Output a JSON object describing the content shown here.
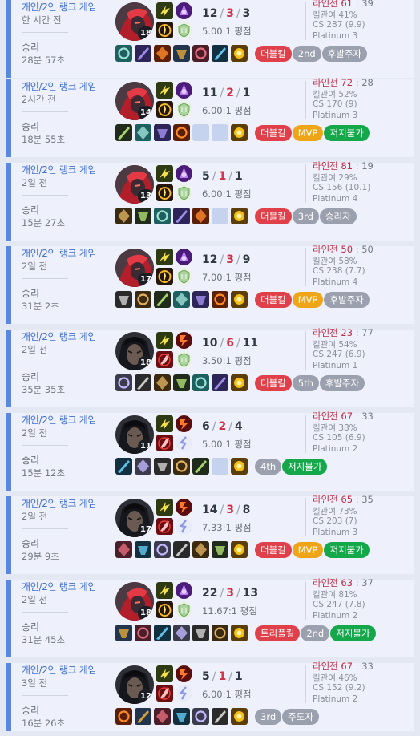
{
  "colors": {
    "accent": "#5a88e0",
    "card_bg": "#eef1fb",
    "death_red": "#d3334a",
    "lane_red": "#c02d45",
    "tag_red": "#e0404a",
    "tag_gray": "#9aa0ad",
    "tag_orange": "#f0a417",
    "tag_green": "#14a84a"
  },
  "matches": [
    {
      "queue": "개인/2인 랭크 게임",
      "time_ago": "한 시간 전",
      "result": "승리",
      "duration": "28분 57초",
      "champion_icon": "red-champion-icon",
      "champion_level": "18",
      "spells": [
        "flash-spell-icon",
        "ignite-spell-icon"
      ],
      "runes": [
        "conqueror-rune-icon",
        "resolve-rune-icon"
      ],
      "kills": "12",
      "deaths": "3",
      "assists": "3",
      "ratio": "5.00:1 평점",
      "items": [
        "item-icon",
        "item-icon",
        "item-icon",
        "item-icon",
        "item-icon",
        "item-icon",
        "ward-icon"
      ],
      "tags": [
        {
          "label": "더블킬",
          "color": "#e0404a"
        },
        {
          "label": "2nd",
          "color": "#9aa0ad"
        },
        {
          "label": "후발주자",
          "color": "#9aa0ad"
        }
      ],
      "lane_label": "라인전",
      "lane_win": "61",
      "lane_loss": "39",
      "kill_participation": "킬관여 41%",
      "cs": "CS 287 (9.9)",
      "tier": "Platinum 3"
    },
    {
      "queue": "개인/2인 랭크 게임",
      "time_ago": "2시간 전",
      "result": "승리",
      "duration": "18분 55초",
      "champion_icon": "red-champion-icon",
      "champion_level": "14",
      "spells": [
        "flash-spell-icon",
        "ignite-spell-icon"
      ],
      "runes": [
        "conqueror-rune-icon",
        "resolve-rune-icon"
      ],
      "kills": "11",
      "deaths": "2",
      "assists": "1",
      "ratio": "6.00:1 평점",
      "items": [
        "item-icon",
        "item-icon",
        "item-icon",
        "item-icon",
        "empty",
        "empty",
        "ward-icon"
      ],
      "tags": [
        {
          "label": "더블킬",
          "color": "#e0404a"
        },
        {
          "label": "MVP",
          "color": "#f0a417"
        },
        {
          "label": "저지불가",
          "color": "#14a84a"
        }
      ],
      "lane_label": "라인전",
      "lane_win": "72",
      "lane_loss": "28",
      "kill_participation": "킬관여 52%",
      "cs": "CS 170 (9)",
      "tier": "Platinum 3"
    },
    {
      "queue": "개인/2인 랭크 게임",
      "time_ago": "2일 전",
      "result": "승리",
      "duration": "15분 27초",
      "champion_icon": "red-champion-icon",
      "champion_level": "13",
      "spells": [
        "flash-spell-icon",
        "ignite-spell-icon"
      ],
      "runes": [
        "conqueror-rune-icon",
        "resolve-rune-icon"
      ],
      "kills": "5",
      "deaths": "1",
      "assists": "1",
      "ratio": "6.00:1 평점",
      "items": [
        "item-icon",
        "item-icon",
        "item-icon",
        "item-icon",
        "item-icon",
        "empty",
        "ward-icon"
      ],
      "tags": [
        {
          "label": "더블킬",
          "color": "#e0404a"
        },
        {
          "label": "3rd",
          "color": "#9aa0ad"
        },
        {
          "label": "승리자",
          "color": "#9aa0ad"
        }
      ],
      "lane_label": "라인전",
      "lane_win": "81",
      "lane_loss": "19",
      "kill_participation": "킬관여 29%",
      "cs": "CS 156 (10.1)",
      "tier": "Platinum 4"
    },
    {
      "queue": "개인/2인 랭크 게임",
      "time_ago": "2일 전",
      "result": "승리",
      "duration": "31분 2초",
      "champion_icon": "red-champion-icon",
      "champion_level": "17",
      "spells": [
        "flash-spell-icon",
        "ignite-spell-icon"
      ],
      "runes": [
        "conqueror-rune-icon",
        "resolve-rune-icon"
      ],
      "kills": "12",
      "deaths": "3",
      "assists": "9",
      "ratio": "7.00:1 평점",
      "items": [
        "item-icon",
        "item-icon",
        "item-icon",
        "item-icon",
        "item-icon",
        "item-icon",
        "ward-icon"
      ],
      "tags": [
        {
          "label": "더블킬",
          "color": "#e0404a"
        },
        {
          "label": "MVP",
          "color": "#f0a417"
        },
        {
          "label": "후발주자",
          "color": "#9aa0ad"
        }
      ],
      "lane_label": "라인전",
      "lane_win": "50",
      "lane_loss": "50",
      "kill_participation": "킬관여 58%",
      "cs": "CS 238 (7.7)",
      "tier": "Platinum 4"
    },
    {
      "queue": "개인/2인 랭크 게임",
      "time_ago": "2일 전",
      "result": "승리",
      "duration": "35분 35초",
      "champion_icon": "dark-champion-icon",
      "champion_level": "18",
      "spells": [
        "flash-spell-icon",
        "smite-spell-icon"
      ],
      "runes": [
        "electrocute-rune-icon",
        "resolve-rune-icon"
      ],
      "kills": "10",
      "deaths": "6",
      "assists": "11",
      "ratio": "3.50:1 평점",
      "items": [
        "item-icon",
        "item-icon",
        "item-icon",
        "item-icon",
        "item-icon",
        "item-icon",
        "ward-icon"
      ],
      "tags": [
        {
          "label": "더블킬",
          "color": "#e0404a"
        },
        {
          "label": "5th",
          "color": "#9aa0ad"
        },
        {
          "label": "후발주자",
          "color": "#9aa0ad"
        }
      ],
      "lane_label": "라인전",
      "lane_win": "23",
      "lane_loss": "77",
      "kill_participation": "킬관여 54%",
      "cs": "CS 247 (6.9)",
      "tier": "Platinum 1"
    },
    {
      "queue": "개인/2인 랭크 게임",
      "time_ago": "2일 전",
      "result": "승리",
      "duration": "15분 12초",
      "champion_icon": "dark-champion-icon",
      "champion_level": "11",
      "spells": [
        "flash-spell-icon",
        "smite-spell-icon"
      ],
      "runes": [
        "electrocute-rune-icon",
        "sorcery-rune-icon"
      ],
      "kills": "6",
      "deaths": "2",
      "assists": "4",
      "ratio": "5.00:1 평점",
      "items": [
        "item-icon",
        "item-icon",
        "item-icon",
        "item-icon",
        "item-icon",
        "empty",
        "ward-icon"
      ],
      "tags": [
        {
          "label": "4th",
          "color": "#9aa0ad"
        },
        {
          "label": "저지불가",
          "color": "#14a84a"
        }
      ],
      "lane_label": "라인전",
      "lane_win": "67",
      "lane_loss": "33",
      "kill_participation": "킬관여 38%",
      "cs": "CS 105 (6.9)",
      "tier": "Platinum 2"
    },
    {
      "queue": "개인/2인 랭크 게임",
      "time_ago": "2일 전",
      "result": "승리",
      "duration": "29분 9초",
      "champion_icon": "dark-champion-icon",
      "champion_level": "17",
      "spells": [
        "flash-spell-icon",
        "smite-spell-icon"
      ],
      "runes": [
        "electrocute-rune-icon",
        "sorcery-rune-icon"
      ],
      "kills": "14",
      "deaths": "3",
      "assists": "8",
      "ratio": "7.33:1 평점",
      "items": [
        "item-icon",
        "item-icon",
        "item-icon",
        "item-icon",
        "item-icon",
        "item-icon",
        "ward-icon"
      ],
      "tags": [
        {
          "label": "더블킬",
          "color": "#e0404a"
        },
        {
          "label": "MVP",
          "color": "#f0a417"
        },
        {
          "label": "저지불가",
          "color": "#14a84a"
        }
      ],
      "lane_label": "라인전",
      "lane_win": "65",
      "lane_loss": "35",
      "kill_participation": "킬관여 73%",
      "cs": "CS 203 (7)",
      "tier": "Platinum 3"
    },
    {
      "queue": "개인/2인 랭크 게임",
      "time_ago": "2일 전",
      "result": "승리",
      "duration": "31분 45초",
      "champion_icon": "red-champion-icon",
      "champion_level": "18",
      "spells": [
        "flash-spell-icon",
        "ignite-spell-icon"
      ],
      "runes": [
        "conqueror-rune-icon",
        "resolve-rune-icon"
      ],
      "kills": "22",
      "deaths": "3",
      "assists": "13",
      "ratio": "11.67:1 평점",
      "items": [
        "item-icon",
        "item-icon",
        "item-icon",
        "item-icon",
        "item-icon",
        "item-icon",
        "ward-icon"
      ],
      "tags": [
        {
          "label": "트리플킬",
          "color": "#e0404a"
        },
        {
          "label": "2nd",
          "color": "#9aa0ad"
        },
        {
          "label": "저지불가",
          "color": "#14a84a"
        }
      ],
      "lane_label": "라인전",
      "lane_win": "63",
      "lane_loss": "37",
      "kill_participation": "킬관여 81%",
      "cs": "CS 247 (7.8)",
      "tier": "Platinum 2"
    },
    {
      "queue": "개인/2인 랭크 게임",
      "time_ago": "3일 전",
      "result": "승리",
      "duration": "16분 26초",
      "champion_icon": "dark-champion-icon",
      "champion_level": "12",
      "spells": [
        "flash-spell-icon",
        "smite-spell-icon"
      ],
      "runes": [
        "electrocute-rune-icon",
        "sorcery-rune-icon"
      ],
      "kills": "5",
      "deaths": "1",
      "assists": "1",
      "ratio": "6.00:1 평점",
      "items": [
        "item-icon",
        "item-icon",
        "item-icon",
        "item-icon",
        "item-icon",
        "item-icon",
        "ward-icon"
      ],
      "tags": [
        {
          "label": "3rd",
          "color": "#9aa0ad"
        },
        {
          "label": "주도자",
          "color": "#9aa0ad"
        }
      ],
      "lane_label": "라인전",
      "lane_win": "67",
      "lane_loss": "33",
      "kill_participation": "킬관여 46%",
      "cs": "CS 152 (9.2)",
      "tier": "Platinum 2"
    }
  ]
}
